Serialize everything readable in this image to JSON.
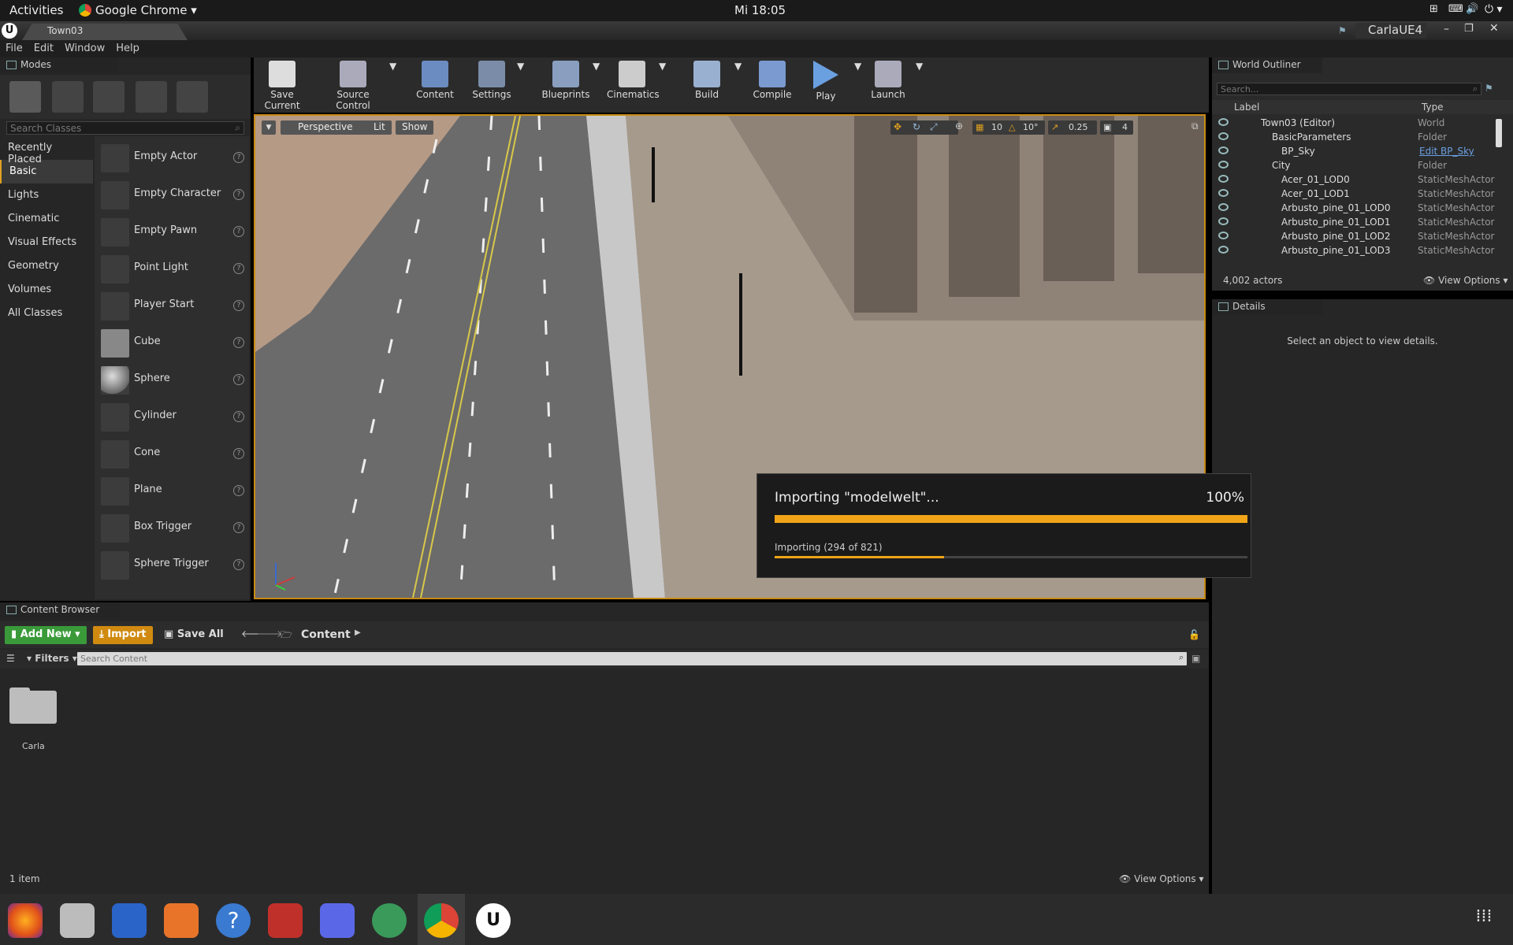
{
  "topbar": {
    "activities": "Activities",
    "app": "Google Chrome",
    "clock": "Mi 18:05"
  },
  "window": {
    "tab_title": "Town03",
    "project": "CarlaUE4"
  },
  "menu": [
    "File",
    "Edit",
    "Window",
    "Help"
  ],
  "modes": {
    "title": "Modes",
    "search_placeholder": "Search Classes",
    "categories": [
      "Recently Placed",
      "Basic",
      "Lights",
      "Cinematic",
      "Visual Effects",
      "Geometry",
      "Volumes",
      "All Classes"
    ],
    "items": [
      "Empty Actor",
      "Empty Character",
      "Empty Pawn",
      "Point Light",
      "Player Start",
      "Cube",
      "Sphere",
      "Cylinder",
      "Cone",
      "Plane",
      "Box Trigger",
      "Sphere Trigger"
    ]
  },
  "toolbar": [
    "Save Current",
    "Source Control",
    "Content",
    "Settings",
    "Blueprints",
    "Cinematics",
    "Build",
    "Compile",
    "Play",
    "Launch"
  ],
  "viewport": {
    "perspective": "Perspective",
    "lit": "Lit",
    "show": "Show",
    "grid": "10",
    "rotation": "10°",
    "scale": "0.25",
    "camera_speed": "4"
  },
  "outliner": {
    "title": "World Outliner",
    "search_placeholder": "Search...",
    "col_label": "Label",
    "col_type": "Type",
    "rows": [
      {
        "label": "Town03 (Editor)",
        "type": "World"
      },
      {
        "label": "BasicParameters",
        "type": "Folder"
      },
      {
        "label": "BP_Sky",
        "type": "Edit BP_Sky"
      },
      {
        "label": "City",
        "type": "Folder"
      },
      {
        "label": "Acer_01_LOD0",
        "type": "StaticMeshActor"
      },
      {
        "label": "Acer_01_LOD1",
        "type": "StaticMeshActor"
      },
      {
        "label": "Arbusto_pine_01_LOD0",
        "type": "StaticMeshActor"
      },
      {
        "label": "Arbusto_pine_01_LOD1",
        "type": "StaticMeshActor"
      },
      {
        "label": "Arbusto_pine_01_LOD2",
        "type": "StaticMeshActor"
      },
      {
        "label": "Arbusto_pine_01_LOD3",
        "type": "StaticMeshActor"
      }
    ],
    "count": "4,002 actors",
    "view_options": "View Options"
  },
  "details": {
    "title": "Details",
    "empty": "Select an object to view details."
  },
  "content_browser": {
    "title": "Content Browser",
    "add_new": "Add New",
    "import": "Import",
    "save_all": "Save All",
    "path": "Content",
    "filters": "Filters",
    "search_placeholder": "Search Content",
    "folder": "Carla",
    "item_count": "1 item",
    "view_options": "View Options"
  },
  "dialog": {
    "title": "Importing \"modelwelt\"...",
    "percent": "100%",
    "progress": 1.0,
    "status": "Importing (294 of 821)",
    "sub_progress": 0.358
  }
}
